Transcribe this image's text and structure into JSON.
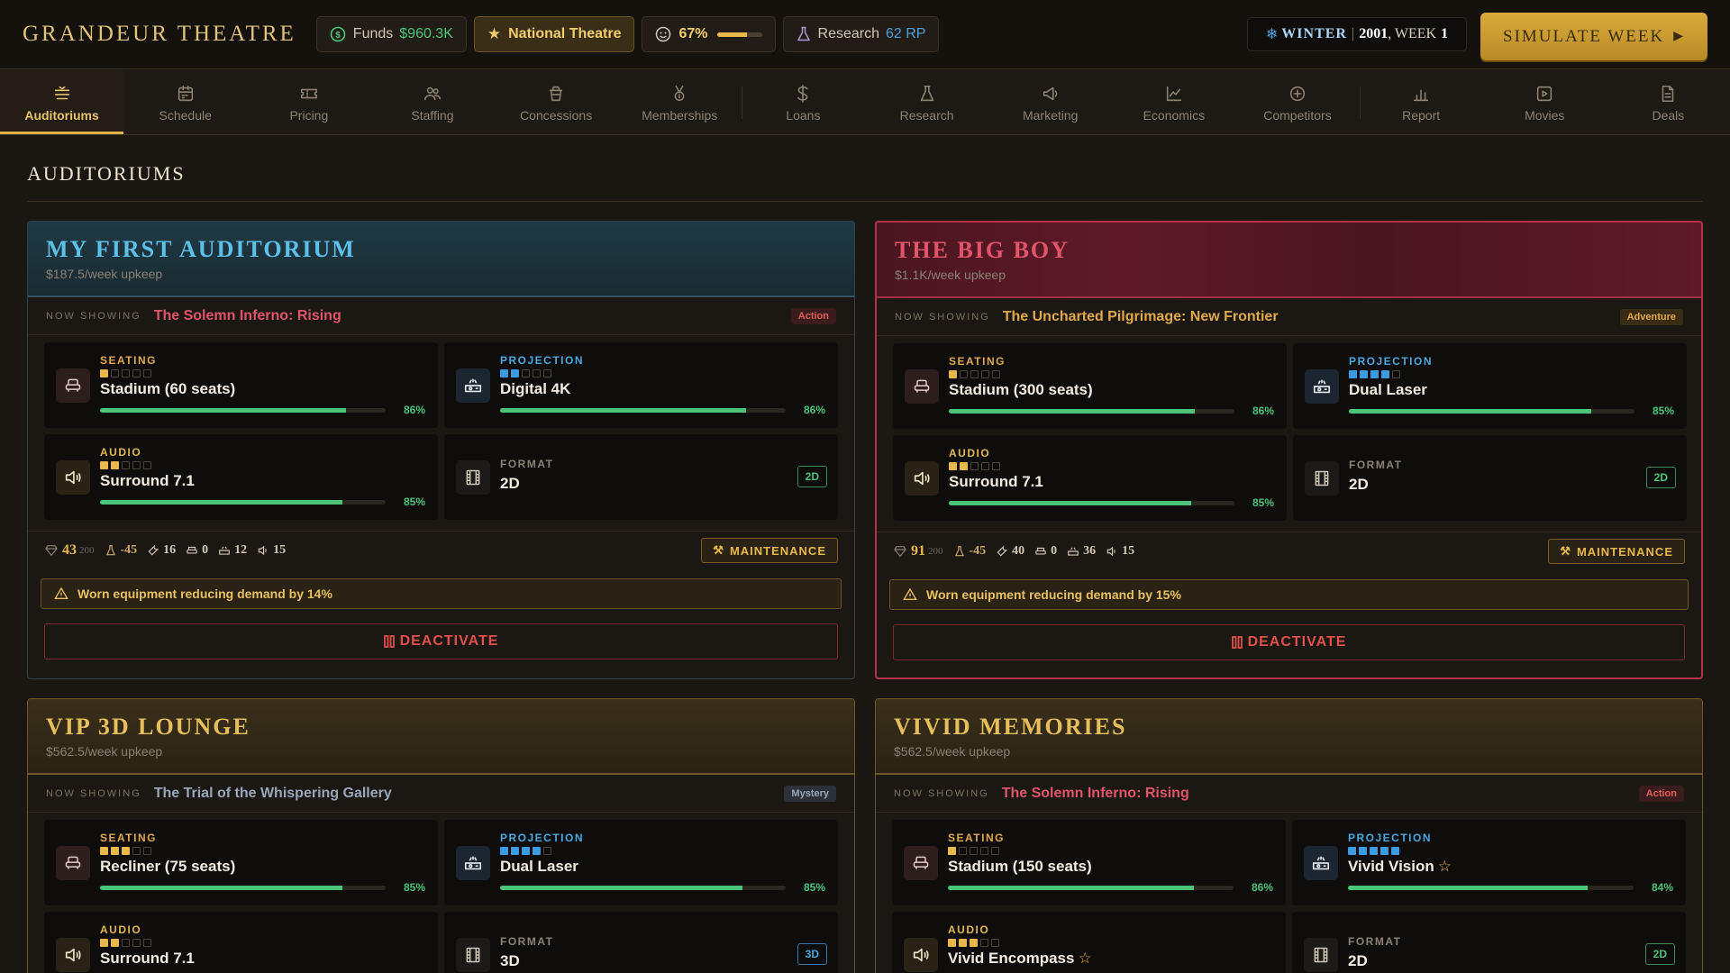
{
  "app": {
    "brand": "GRANDEUR THEATRE",
    "funds_label": "Funds",
    "funds_value": "$960.3K",
    "theatre_rank": "National Theatre",
    "mood_value": "67%",
    "mood_fraction": 0.67,
    "research_label": "Research",
    "research_value": "62 RP",
    "season": "WINTER",
    "year": "2001",
    "week_label": ", WEEK",
    "week": "1",
    "simulate_label": "SIMULATE WEEK"
  },
  "nav": [
    {
      "label": "Auditoriums",
      "icon": "auditorium-icon",
      "active": true
    },
    {
      "label": "Schedule",
      "icon": "calendar-icon"
    },
    {
      "label": "Pricing",
      "icon": "ticket-icon"
    },
    {
      "label": "Staffing",
      "icon": "users-icon"
    },
    {
      "label": "Concessions",
      "icon": "cup-icon"
    },
    {
      "label": "Memberships",
      "icon": "medal-icon"
    },
    {
      "label": "Loans",
      "icon": "dollar-icon"
    },
    {
      "label": "Research",
      "icon": "flask-icon"
    },
    {
      "label": "Marketing",
      "icon": "megaphone-icon"
    },
    {
      "label": "Economics",
      "icon": "line-chart-icon"
    },
    {
      "label": "Competitors",
      "icon": "target-icon"
    },
    {
      "label": "Report",
      "icon": "bar-chart-icon"
    },
    {
      "label": "Movies",
      "icon": "play-icon"
    },
    {
      "label": "Deals",
      "icon": "document-icon"
    }
  ],
  "page": {
    "title": "AUDITORIUMS"
  },
  "labels": {
    "now_showing": "NOW SHOWING",
    "seating": "SEATING",
    "projection": "PROJECTION",
    "audio": "AUDIO",
    "format": "FORMAT",
    "maintenance": "MAINTENANCE",
    "deactivate": "DEACTIVATE",
    "rep_max": "200"
  },
  "auditoriums": [
    {
      "name": "MY FIRST AUDITORIUM",
      "upkeep": "$187.5/week upkeep",
      "movie": "The Solemn Inferno: Rising",
      "movie_color": "#e2546a",
      "genre": "Action",
      "seating": {
        "value": "Stadium (60 seats)",
        "level": 1,
        "pct": "86%",
        "fill": 0.86
      },
      "projection": {
        "value": "Digital 4K",
        "level": 2,
        "pct": "86%",
        "fill": 0.86
      },
      "audio": {
        "value": "Surround 7.1",
        "level": 2,
        "pct": "85%",
        "fill": 0.85
      },
      "format": {
        "value": "2D",
        "badge": "2D"
      },
      "stats": {
        "rep": "43",
        "delta": "-45",
        "staff": "16",
        "seats": "0",
        "proj": "12",
        "audio": "15"
      },
      "warning": "Worn equipment reducing demand by 14%"
    },
    {
      "name": "THE BIG BOY",
      "upkeep": "$1.1K/week upkeep",
      "movie": "The Uncharted Pilgrimage: New Frontier",
      "movie_color": "#e2a84a",
      "genre": "Adventure",
      "seating": {
        "value": "Stadium (300 seats)",
        "level": 1,
        "pct": "86%",
        "fill": 0.86
      },
      "projection": {
        "value": "Dual Laser",
        "level": 4,
        "pct": "85%",
        "fill": 0.85
      },
      "audio": {
        "value": "Surround 7.1",
        "level": 2,
        "pct": "85%",
        "fill": 0.85
      },
      "format": {
        "value": "2D",
        "badge": "2D"
      },
      "stats": {
        "rep": "91",
        "delta": "-45",
        "staff": "40",
        "seats": "0",
        "proj": "36",
        "audio": "15"
      },
      "warning": "Worn equipment reducing demand by 15%"
    },
    {
      "name": "VIP 3D LOUNGE",
      "upkeep": "$562.5/week upkeep",
      "movie": "The Trial of the Whispering Gallery",
      "movie_color": "#9aa6b8",
      "genre": "Mystery",
      "seating": {
        "value": "Recliner (75 seats)",
        "level": 3,
        "pct": "85%",
        "fill": 0.85
      },
      "projection": {
        "value": "Dual Laser",
        "level": 4,
        "pct": "85%",
        "fill": 0.85
      },
      "audio": {
        "value": "Surround 7.1",
        "level": 2
      },
      "format": {
        "value": "3D",
        "badge": "3D"
      }
    },
    {
      "name": "VIVID MEMORIES",
      "upkeep": "$562.5/week upkeep",
      "movie": "The Solemn Inferno: Rising",
      "movie_color": "#e2546a",
      "genre": "Action",
      "seating": {
        "value": "Stadium (150 seats)",
        "level": 1,
        "pct": "86%",
        "fill": 0.86
      },
      "projection": {
        "value": "Vivid Vision",
        "level": 5,
        "pct": "84%",
        "fill": 0.84,
        "star": true
      },
      "audio": {
        "value": "Vivid Encompass",
        "level": 3,
        "star": true
      },
      "format": {
        "value": "2D",
        "badge": "2D"
      }
    }
  ]
}
